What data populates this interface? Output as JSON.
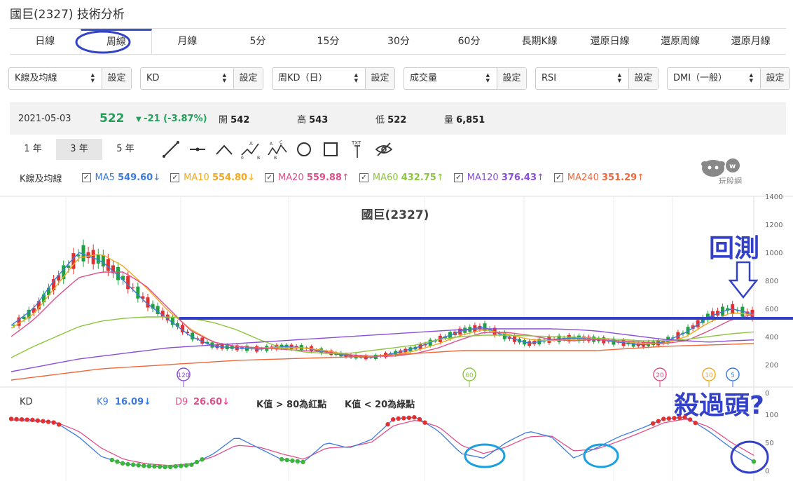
{
  "page": {
    "title": "國巨(2327) 技術分析"
  },
  "tabs": [
    {
      "label": "日線",
      "active": false
    },
    {
      "label": "周線",
      "active": true
    },
    {
      "label": "月線",
      "active": false
    },
    {
      "label": "5分",
      "active": false
    },
    {
      "label": "15分",
      "active": false
    },
    {
      "label": "30分",
      "active": false
    },
    {
      "label": "60分",
      "active": false
    },
    {
      "label": "長期K線",
      "active": false
    },
    {
      "label": "還原日線",
      "active": false
    },
    {
      "label": "還原周線",
      "active": false
    },
    {
      "label": "還原月線",
      "active": false
    }
  ],
  "selectors": [
    {
      "value": "K線及均線",
      "button": "設定"
    },
    {
      "value": "KD",
      "button": "設定"
    },
    {
      "value": "周KD（日）",
      "button": "設定"
    },
    {
      "value": "成交量",
      "button": "設定"
    },
    {
      "value": "RSI",
      "button": "設定"
    },
    {
      "value": "DMI（一般）",
      "button": "設定"
    }
  ],
  "quote": {
    "date": "2021-05-03",
    "price": "522",
    "change": "-21 (-3.87%)",
    "open_label": "開",
    "open": "542",
    "high_label": "高",
    "high": "543",
    "low_label": "低",
    "low": "522",
    "volume_label": "量",
    "volume": "6,851"
  },
  "ranges": [
    {
      "label": "1 年",
      "active": false
    },
    {
      "label": "3 年",
      "active": true
    },
    {
      "label": "5 年",
      "active": false
    }
  ],
  "tools": [
    "line-tool-icon",
    "segment-tool-icon",
    "angle-tool-icon",
    "abc-pattern-icon",
    "abcd-pattern-icon",
    "circle-tool-icon",
    "rectangle-tool-icon",
    "text-tool-icon",
    "hide-eye-icon"
  ],
  "tool_text": {
    "abc": "A",
    "txt": "TXT"
  },
  "ma_legend": {
    "group": "K線及均線",
    "items": [
      {
        "name": "MA5",
        "value": "549.60",
        "arrow": "↓",
        "color": "#3b7be0"
      },
      {
        "name": "MA10",
        "value": "554.80",
        "arrow": "↓",
        "color": "#f2a822"
      },
      {
        "name": "MA20",
        "value": "559.88",
        "arrow": "↑",
        "color": "#e0508a"
      },
      {
        "name": "MA60",
        "value": "432.75",
        "arrow": "↑",
        "color": "#8cc63f"
      },
      {
        "name": "MA120",
        "value": "376.43",
        "arrow": "↑",
        "color": "#8a4fd8"
      },
      {
        "name": "MA240",
        "value": "351.29",
        "arrow": "↑",
        "color": "#f0673a"
      }
    ]
  },
  "logo_text": "玩股網",
  "chart": {
    "title": "國巨(2327)",
    "y_ticks": [
      "1400",
      "1200",
      "1000",
      "800",
      "600",
      "400",
      "200",
      "0"
    ],
    "ma_markers": [
      "120",
      "60",
      "20",
      "10",
      "5"
    ],
    "annotation_top": "回測",
    "annotation_kd": "殺過頭?",
    "colors": {
      "up": "#e03030",
      "down": "#20a040",
      "support": "#3341c9",
      "annotation": "#3341c9",
      "ellipse": "#1aa0e0"
    }
  },
  "kd": {
    "label": "KD",
    "k": "K9",
    "k_value": "16.09",
    "k_arrow": "↓",
    "d": "D9",
    "d_value": "26.60",
    "d_arrow": "↓",
    "note1": "K值 > 80為紅點",
    "note2": "K值 < 20為綠點",
    "y_ticks": [
      "100",
      "50",
      "0"
    ]
  },
  "chart_data": {
    "type": "candlestick",
    "title": "國巨(2327)",
    "ylim": [
      0,
      1400
    ],
    "series": [
      {
        "name": "MA5",
        "values": [
          480,
          600,
          820,
          1000,
          940,
          800,
          640,
          520,
          400,
          330,
          320,
          310,
          330,
          320,
          290,
          260,
          250,
          280,
          320,
          380,
          440,
          470,
          400,
          350,
          380,
          390,
          380,
          360,
          340,
          360,
          430,
          540,
          600,
          560
        ]
      },
      {
        "name": "MA10",
        "values": [
          460,
          560,
          760,
          960,
          990,
          900,
          750,
          580,
          450,
          360,
          330,
          320,
          320,
          320,
          300,
          270,
          260,
          270,
          300,
          350,
          410,
          450,
          420,
          380,
          370,
          380,
          380,
          370,
          350,
          350,
          400,
          500,
          570,
          555
        ]
      },
      {
        "name": "MA20",
        "values": [
          400,
          520,
          680,
          820,
          860,
          860,
          760,
          600,
          440,
          360,
          330,
          320,
          310,
          300,
          290,
          270,
          260,
          260,
          280,
          320,
          380,
          430,
          430,
          410,
          380,
          370,
          380,
          370,
          360,
          350,
          370,
          440,
          520,
          560
        ]
      },
      {
        "name": "MA60",
        "values": [
          250,
          330,
          400,
          470,
          510,
          530,
          540,
          540,
          530,
          500,
          450,
          380,
          320,
          290,
          280,
          280,
          300,
          320,
          340,
          380,
          400,
          410,
          410,
          405,
          400,
          395,
          390,
          380,
          370,
          370,
          380,
          400,
          420,
          433
        ]
      },
      {
        "name": "MA120",
        "values": [
          150,
          180,
          210,
          240,
          260,
          280,
          300,
          320,
          330,
          340,
          350,
          360,
          370,
          380,
          390,
          400,
          410,
          420,
          430,
          440,
          450,
          455,
          455,
          455,
          455,
          450,
          440,
          420,
          400,
          380,
          370,
          360,
          370,
          376
        ]
      },
      {
        "name": "MA240",
        "values": [
          90,
          110,
          130,
          150,
          170,
          180,
          190,
          200,
          210,
          220,
          230,
          235,
          240,
          245,
          250,
          255,
          260,
          270,
          280,
          290,
          300,
          300,
          300,
          300,
          300,
          300,
          300,
          310,
          320,
          330,
          335,
          340,
          345,
          351
        ]
      }
    ],
    "kd_k": [
      92,
      90,
      85,
      60,
      25,
      12,
      8,
      6,
      10,
      30,
      60,
      40,
      20,
      15,
      50,
      40,
      55,
      92,
      95,
      70,
      30,
      22,
      50,
      70,
      60,
      22,
      40,
      60,
      75,
      92,
      95,
      70,
      40,
      16
    ],
    "kd_d": [
      90,
      88,
      86,
      70,
      40,
      20,
      12,
      9,
      12,
      25,
      45,
      42,
      30,
      20,
      40,
      42,
      50,
      80,
      90,
      78,
      45,
      30,
      42,
      60,
      62,
      35,
      38,
      52,
      68,
      85,
      92,
      78,
      50,
      27
    ]
  }
}
